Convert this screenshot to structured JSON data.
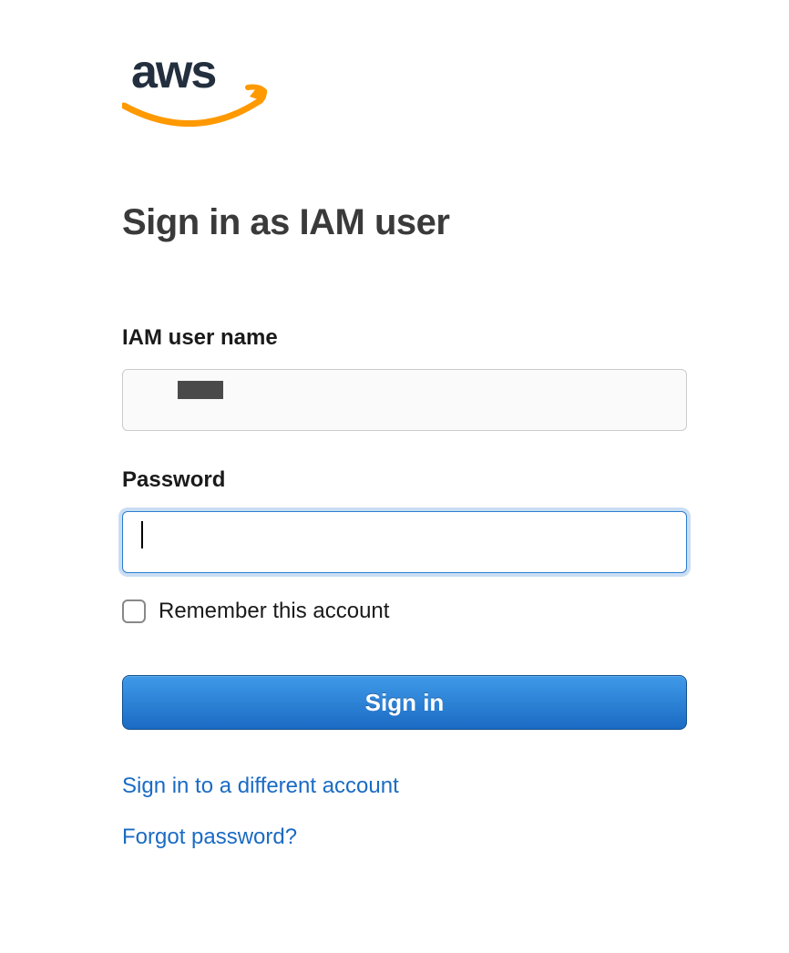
{
  "logo": {
    "name": "aws-logo"
  },
  "heading": "Sign in as IAM user",
  "form": {
    "username": {
      "label": "IAM user name",
      "value": ""
    },
    "password": {
      "label": "Password",
      "value": ""
    },
    "remember": {
      "label": "Remember this account",
      "checked": false
    },
    "submit_label": "Sign in"
  },
  "links": {
    "different_account": "Sign in to a different account",
    "forgot_password": "Forgot password?"
  }
}
